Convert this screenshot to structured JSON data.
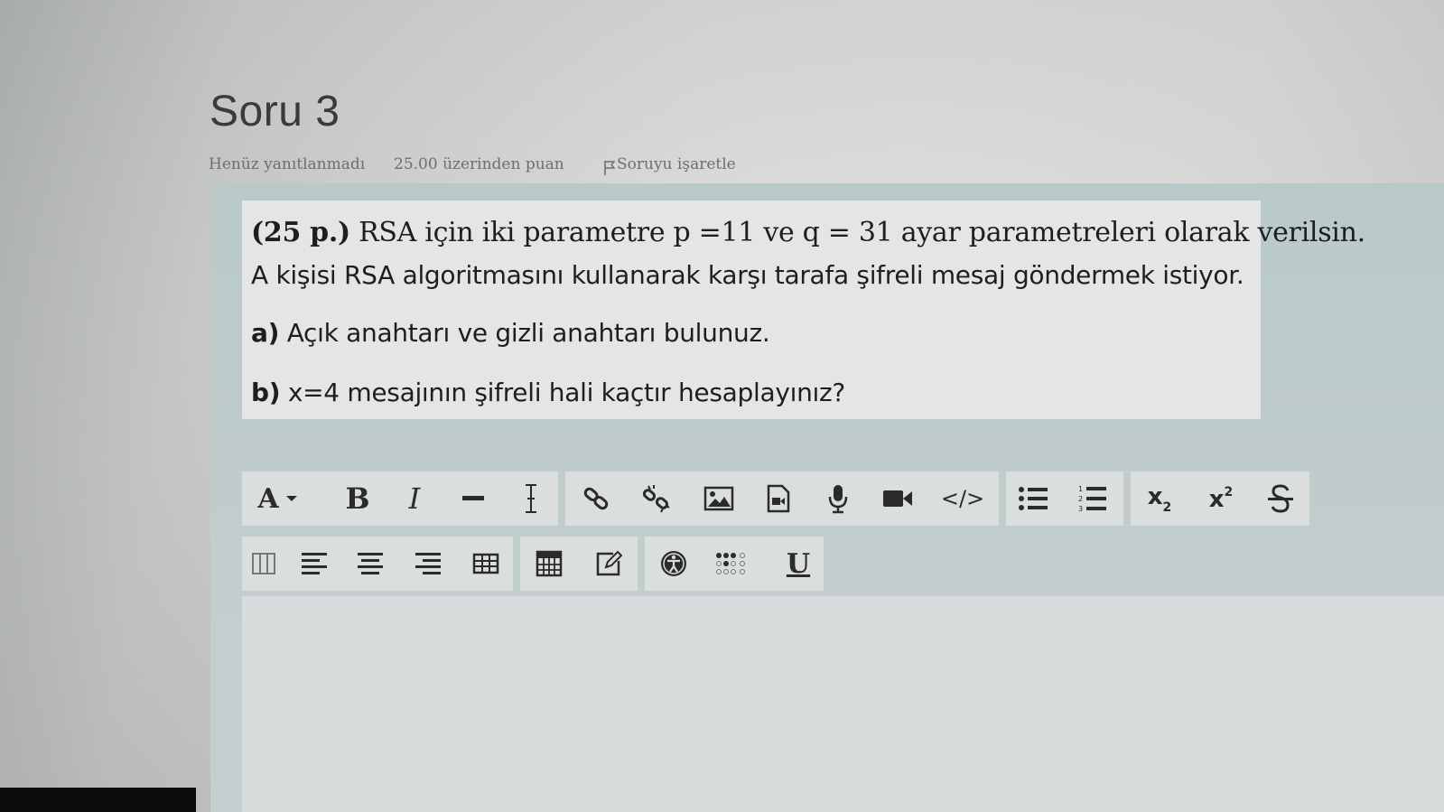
{
  "question": {
    "title": "Soru 3",
    "status": "Henüz yanıtlanmadı",
    "points": "25.00 üzerinden puan",
    "flag_label": "Soruyu işaretle"
  },
  "content": {
    "line1_bold": "(25 p.)",
    "line1_text": " RSA için iki parametre p =11 ve q = 31 ayar parametreleri olarak verilsin.",
    "line2": "A kişisi RSA algoritmasını kullanarak karşı tarafa şifreli mesaj göndermek istiyor.",
    "part_a_label": "a)",
    "part_a_text": " Açık anahtarı ve gizli anahtarı bulunuz.",
    "part_b_label": "b)",
    "part_b_text": " x=4 mesajının şifreli hali kaçtır hesaplayınız?"
  },
  "toolbar": {
    "font_label": "A",
    "bold_label": "B",
    "italic_label": "I",
    "underline_label": "U",
    "subscript_label": "x",
    "subscript_mark": "2",
    "superscript_label": "x",
    "superscript_mark": "2",
    "code_label": "</>",
    "icons": [
      "font-color-icon",
      "bold-icon",
      "italic-icon",
      "horizontal-rule-icon",
      "text-cursor-icon",
      "link-icon",
      "unlink-icon",
      "image-icon",
      "media-file-icon",
      "microphone-icon",
      "video-camera-icon",
      "code-icon",
      "bullet-list-icon",
      "numbered-list-icon",
      "subscript-icon",
      "superscript-icon",
      "strikethrough-icon",
      "columns-icon",
      "align-left-icon",
      "align-center-icon",
      "align-right-icon",
      "table-icon",
      "calculator-icon",
      "edit-icon",
      "accessibility-icon",
      "braille-icon",
      "underline-icon"
    ]
  },
  "colors": {
    "panel": "#bdcaca",
    "question_box": "#e4e6e6",
    "toolbar_group": "#dadedd",
    "text": "#1e1e1e",
    "meta_text": "#6e6e6e"
  }
}
